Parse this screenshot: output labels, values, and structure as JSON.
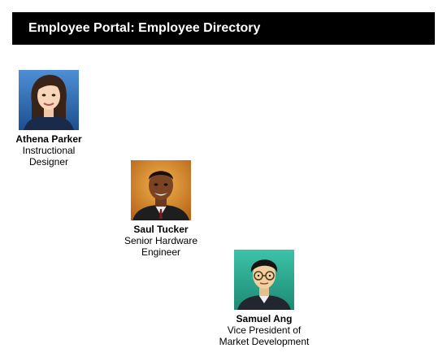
{
  "header": {
    "title": "Employee Portal: Employee Directory"
  },
  "employees": [
    {
      "name": "Athena Parker",
      "title": "Instructional Designer",
      "avatar": "female-avatar-icon"
    },
    {
      "name": "Saul Tucker",
      "title": "Senior Hardware Engineer",
      "avatar": "male-avatar-icon"
    },
    {
      "name": "Samuel Ang",
      "title": "Vice President of Market Development",
      "avatar": "male-avatar-glasses-icon"
    }
  ],
  "colors": {
    "header_bg": "#000000",
    "header_text": "#ffffff",
    "avatar1_bg": "#2f6fb6",
    "avatar2_bg": "#d38b2c",
    "avatar3_bg": "#2aa58e"
  }
}
